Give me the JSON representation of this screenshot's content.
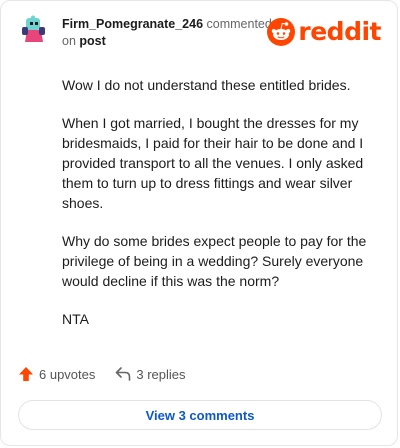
{
  "comment": {
    "author": "Firm_Pomegranate_246",
    "action_text": "commented",
    "on_text": "on",
    "post_link": "post",
    "paragraphs": [
      "Wow I do not understand these entitled brides.",
      "When I got married, I bought the dresses for my bridesmaids, I paid for their hair to be done and I provided transport to all the venues. I only asked them to turn up to dress fittings and wear silver shoes.",
      "Why do some brides expect people to pay for the privilege of being in a wedding? Surely everyone would decline if this was the norm?",
      "NTA"
    ]
  },
  "brand": {
    "name": "reddit",
    "color": "#ff4500",
    "icon": "reddit-snoo-icon"
  },
  "actions": {
    "upvotes": "6 upvotes",
    "replies": "3 replies",
    "upvote_color": "#ff4500"
  },
  "view_comments_label": "View 3 comments",
  "link_color": "#0c59c9"
}
